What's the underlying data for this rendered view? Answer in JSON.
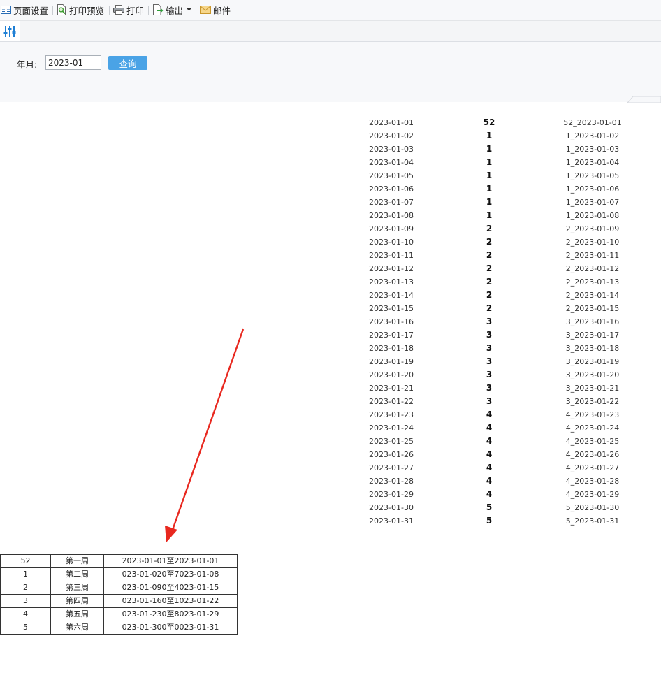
{
  "toolbar": {
    "page_setup": "页面设置",
    "print_preview": "打印预览",
    "print": "打印",
    "export": "输出",
    "mail": "邮件"
  },
  "params": {
    "label": "年月:",
    "value": "2023-01",
    "query_button": "查询"
  },
  "date_rows": [
    {
      "date": "2023-01-01",
      "week": "52",
      "key": "52_2023-01-01"
    },
    {
      "date": "2023-01-02",
      "week": "1",
      "key": "1_2023-01-02"
    },
    {
      "date": "2023-01-03",
      "week": "1",
      "key": "1_2023-01-03"
    },
    {
      "date": "2023-01-04",
      "week": "1",
      "key": "1_2023-01-04"
    },
    {
      "date": "2023-01-05",
      "week": "1",
      "key": "1_2023-01-05"
    },
    {
      "date": "2023-01-06",
      "week": "1",
      "key": "1_2023-01-06"
    },
    {
      "date": "2023-01-07",
      "week": "1",
      "key": "1_2023-01-07"
    },
    {
      "date": "2023-01-08",
      "week": "1",
      "key": "1_2023-01-08"
    },
    {
      "date": "2023-01-09",
      "week": "2",
      "key": "2_2023-01-09"
    },
    {
      "date": "2023-01-10",
      "week": "2",
      "key": "2_2023-01-10"
    },
    {
      "date": "2023-01-11",
      "week": "2",
      "key": "2_2023-01-11"
    },
    {
      "date": "2023-01-12",
      "week": "2",
      "key": "2_2023-01-12"
    },
    {
      "date": "2023-01-13",
      "week": "2",
      "key": "2_2023-01-13"
    },
    {
      "date": "2023-01-14",
      "week": "2",
      "key": "2_2023-01-14"
    },
    {
      "date": "2023-01-15",
      "week": "2",
      "key": "2_2023-01-15"
    },
    {
      "date": "2023-01-16",
      "week": "3",
      "key": "3_2023-01-16"
    },
    {
      "date": "2023-01-17",
      "week": "3",
      "key": "3_2023-01-17"
    },
    {
      "date": "2023-01-18",
      "week": "3",
      "key": "3_2023-01-18"
    },
    {
      "date": "2023-01-19",
      "week": "3",
      "key": "3_2023-01-19"
    },
    {
      "date": "2023-01-20",
      "week": "3",
      "key": "3_2023-01-20"
    },
    {
      "date": "2023-01-21",
      "week": "3",
      "key": "3_2023-01-21"
    },
    {
      "date": "2023-01-22",
      "week": "3",
      "key": "3_2023-01-22"
    },
    {
      "date": "2023-01-23",
      "week": "4",
      "key": "4_2023-01-23"
    },
    {
      "date": "2023-01-24",
      "week": "4",
      "key": "4_2023-01-24"
    },
    {
      "date": "2023-01-25",
      "week": "4",
      "key": "4_2023-01-25"
    },
    {
      "date": "2023-01-26",
      "week": "4",
      "key": "4_2023-01-26"
    },
    {
      "date": "2023-01-27",
      "week": "4",
      "key": "4_2023-01-27"
    },
    {
      "date": "2023-01-28",
      "week": "4",
      "key": "4_2023-01-28"
    },
    {
      "date": "2023-01-29",
      "week": "4",
      "key": "4_2023-01-29"
    },
    {
      "date": "2023-01-30",
      "week": "5",
      "key": "5_2023-01-30"
    },
    {
      "date": "2023-01-31",
      "week": "5",
      "key": "5_2023-01-31"
    }
  ],
  "week_table": [
    {
      "num": "52",
      "name": "第一周",
      "range": "2023-01-01至2023-01-01"
    },
    {
      "num": "1",
      "name": "第二周",
      "range": "023-01-020至7023-01-08"
    },
    {
      "num": "2",
      "name": "第三周",
      "range": "023-01-090至4023-01-15"
    },
    {
      "num": "3",
      "name": "第四周",
      "range": "023-01-160至1023-01-22"
    },
    {
      "num": "4",
      "name": "第五周",
      "range": "023-01-230至8023-01-29"
    },
    {
      "num": "5",
      "name": "第六周",
      "range": "023-01-300至0023-01-31"
    }
  ],
  "colors": {
    "accent": "#4aa3e6",
    "arrow": "#e8281f"
  },
  "icons": {
    "page_setup": "page-setup-icon",
    "print_preview": "print-preview-icon",
    "print": "printer-icon",
    "export": "export-icon",
    "mail": "mail-icon",
    "params_tab": "sliders-icon"
  }
}
